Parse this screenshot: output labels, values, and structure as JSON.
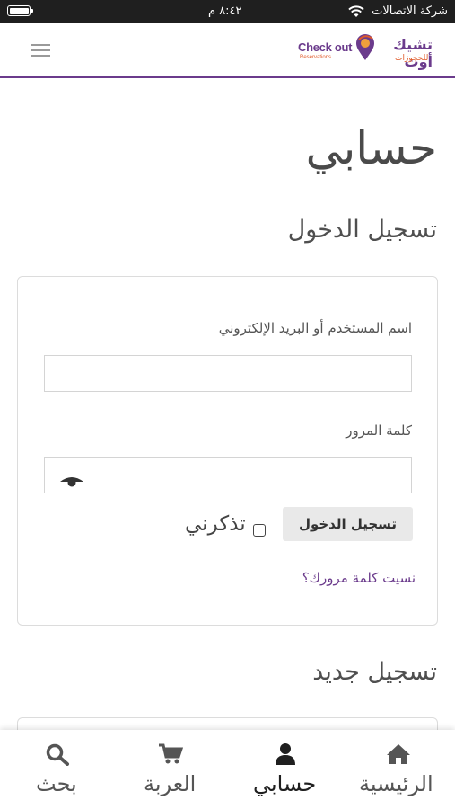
{
  "status_bar": {
    "time": "٨:٤٢ م",
    "carrier": "شركة الاتصالات"
  },
  "header": {
    "logo_en": "Check out",
    "logo_en_sub": "Reservations",
    "logo_ar": "تشيك أوت",
    "logo_ar_sub": "للحجوزات"
  },
  "page": {
    "title": "حسابي",
    "login_section_title": "تسجيل الدخول",
    "register_section_title": "تسجيل جديد"
  },
  "login_form": {
    "username_label": "اسم المستخدم أو البريد الإلكتروني",
    "username_value": "",
    "password_label": "كلمة المرور",
    "password_value": "",
    "login_button": "تسجيل الدخول",
    "remember_label": "تذكرني",
    "remember_checked": false,
    "forgot_link": "نسيت كلمة مرورك؟"
  },
  "bottom_nav": [
    {
      "label": "الرئيسية",
      "icon": "home-icon",
      "active": false
    },
    {
      "label": "حسابي",
      "icon": "user-icon",
      "active": true
    },
    {
      "label": "العربة",
      "icon": "cart-icon",
      "active": false
    },
    {
      "label": "بحث",
      "icon": "search-icon",
      "active": false
    }
  ],
  "colors": {
    "brand_purple": "#6b3b8c",
    "brand_orange": "#e05a2a",
    "status_bar_bg": "#1f1f1f"
  }
}
